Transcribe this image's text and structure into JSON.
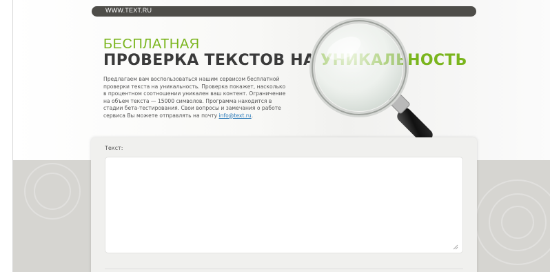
{
  "header": {
    "site_url": "WWW.TEXT.RU"
  },
  "hero": {
    "title_line1": "БЕСПЛАТНАЯ",
    "title_line2_main": "ПРОВЕРКА ТЕКСТОВ НА ",
    "title_line2_highlight": "УНИКАЛЬНОСТЬ",
    "intro_text": "Предлагаем вам воспользоваться нашим сервисом бесплатной проверки текста на уникальность. Проверка покажет, насколько в процентном соотношении уникален ваш контент. Ограничение на объем текста — 15000 символов. Программа находится в стадии бета-тестирования. Свои вопросы и замечания о работе сервиса Вы можете отправлять на почту ",
    "contact_email": "info@text.ru",
    "intro_end": ".",
    "image_icon": "magnifier-icon"
  },
  "form": {
    "text_label": "Текст:",
    "text_value": ""
  },
  "colors": {
    "accent": "#7ab51d",
    "topbar": "#4e4d49",
    "link": "#2a79b8"
  }
}
